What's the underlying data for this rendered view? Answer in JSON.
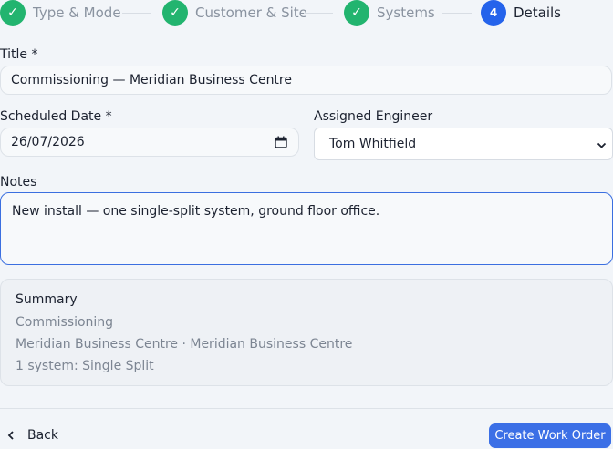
{
  "stepper": {
    "steps": [
      {
        "label": "Type & Mode",
        "state": "done",
        "marker": "✓"
      },
      {
        "label": "Customer & Site",
        "state": "done",
        "marker": "✓"
      },
      {
        "label": "Systems",
        "state": "done",
        "marker": "✓"
      },
      {
        "label": "Details",
        "state": "active",
        "marker": "4"
      }
    ]
  },
  "form": {
    "title_label": "Title *",
    "title_value": "Commissioning — Meridian Business Centre",
    "scheduled_label": "Scheduled Date *",
    "scheduled_value": "26/07/2026",
    "engineer_label": "Assigned Engineer",
    "engineer_value": "Tom Whitfield",
    "notes_label": "Notes",
    "notes_value": "New install — one single-split system, ground floor office."
  },
  "summary": {
    "heading": "Summary",
    "lines": [
      "Commissioning",
      "Meridian Business Centre · Meridian Business Centre",
      "1 system: Single Split"
    ]
  },
  "footer": {
    "back_label": "Back",
    "submit_label": "Create Work Order"
  },
  "colors": {
    "done": "#22b46f",
    "active": "#2563eb",
    "primary_button": "#3b6fe6",
    "focus_border": "#3b6fe0"
  }
}
